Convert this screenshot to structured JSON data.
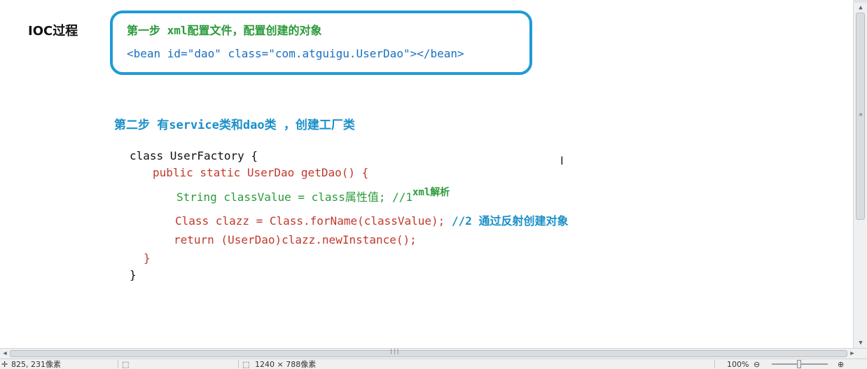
{
  "header": {
    "title": "IOC过程"
  },
  "step1": {
    "title": "第一步 xml配置文件，配置创建的对象",
    "code": "<bean id=\"dao\" class=\"com.atguigu.UserDao\"></bean>"
  },
  "step2": {
    "title": "第二步 有service类和dao类 ，创建工厂类"
  },
  "code": {
    "line1": "class UserFactory {",
    "line2": "public static UserDao getDao() {",
    "line3_main": "String classValue = class属性值; //1",
    "line3_sup": "xml解析",
    "line4_code": "Class clazz = Class.forName(classValue);",
    "line4_comment": "//2 通过反射创建对象",
    "line5": "return (UserDao)clazz.newInstance();",
    "line6": "}",
    "line7": "}"
  },
  "cursor": {
    "glyph": "I"
  },
  "statusbar": {
    "coords": "825, 231像素",
    "size": "1240 × 788像素",
    "zoom": "100%"
  },
  "icons": {
    "scroll_up": "scroll-up-arrow-icon",
    "scroll_down": "scroll-down-arrow-icon",
    "scroll_left": "scroll-left-arrow-icon",
    "scroll_right": "scroll-right-arrow-icon",
    "zoom_out": "zoom-out-icon",
    "zoom_in": "zoom-in-icon"
  },
  "colors": {
    "box_border": "#1f9ad6",
    "green": "#2a9a3a",
    "red": "#c0392b",
    "blue": "#1a8fc8"
  }
}
